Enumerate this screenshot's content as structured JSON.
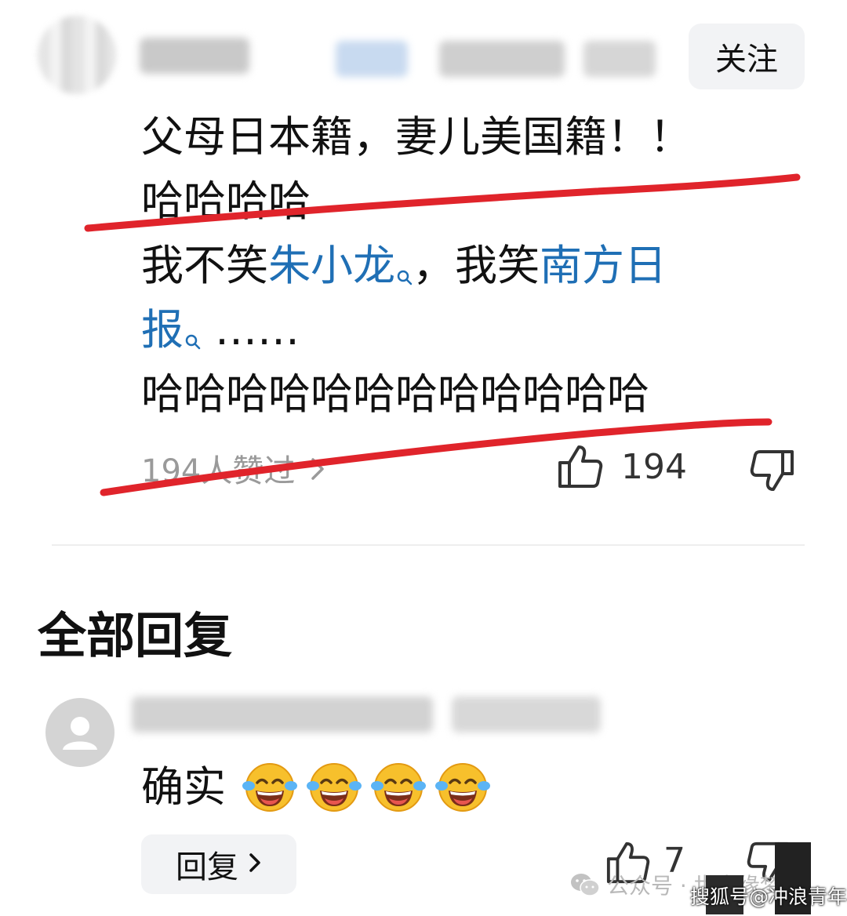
{
  "header": {
    "follow_label": "关注"
  },
  "comment": {
    "line1": "父母日本籍，妻儿美国籍！！",
    "line2": "哈哈哈哈",
    "line3_prefix": "我不笑",
    "line3_link1": "朱小龙",
    "line3_middle": "，我笑",
    "line3_link2a": "南方日",
    "line4_link2b": "报",
    "line4_suffix": "……",
    "line5": "哈哈哈哈哈哈哈哈哈哈哈哈",
    "likes_summary": "194人赞过",
    "like_count": "194"
  },
  "replies_section": {
    "title": "全部回复",
    "reply": {
      "text": "确实",
      "emoji_count": 4,
      "reply_button_label": "回复",
      "like_count": "7"
    }
  },
  "watermarks": {
    "official_account": "公众号 · 世事缘梦行",
    "sohu": "搜狐号@冲浪青年"
  },
  "colors": {
    "link": "#1f6fb5",
    "underline": "#e0242b",
    "button_bg": "#f2f3f5"
  },
  "icons": [
    "search-icon",
    "thumbs-up-icon",
    "thumbs-down-icon",
    "chevron-right-icon",
    "tears-of-joy-emoji",
    "wechat-icon",
    "default-avatar-icon"
  ]
}
